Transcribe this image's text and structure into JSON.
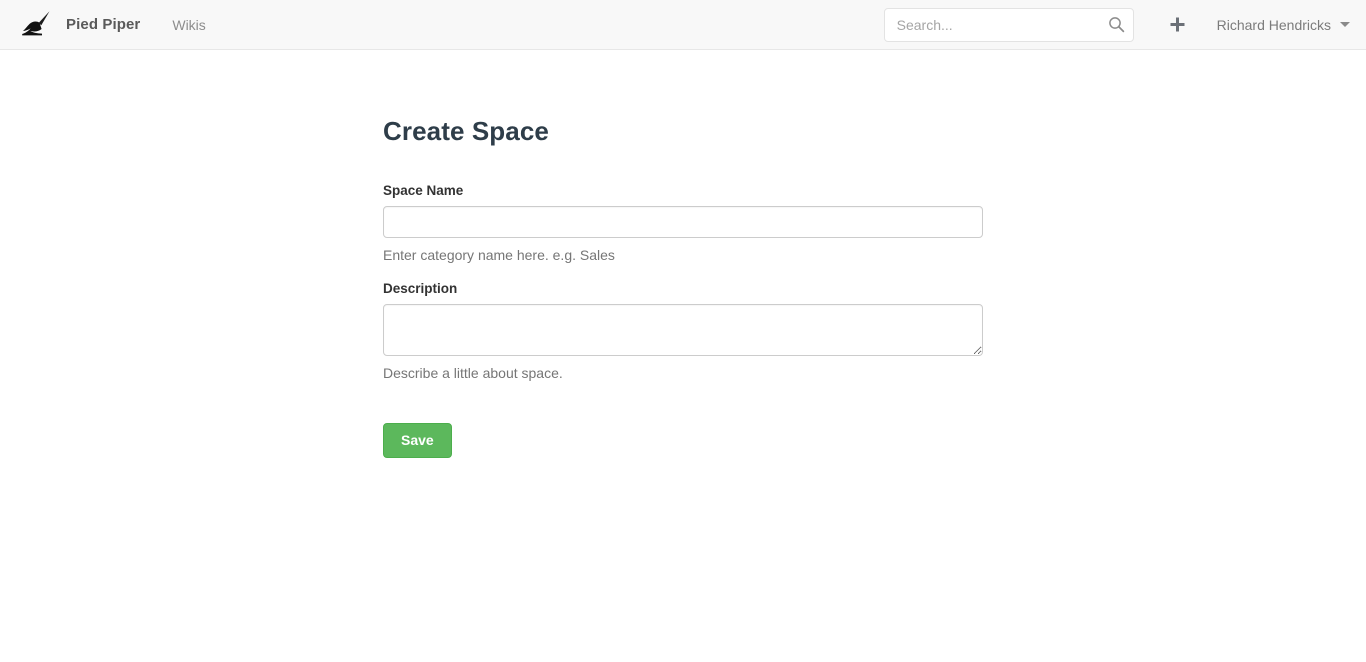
{
  "navbar": {
    "logo_icon": "quill-pen-icon",
    "brand": "Pied Piper",
    "links": [
      {
        "label": "Wikis",
        "name": "wikis"
      }
    ],
    "search": {
      "placeholder": "Search...",
      "value": "",
      "icon": "search-icon"
    },
    "add_button_icon": "plus-icon",
    "user": {
      "name": "Richard Hendricks",
      "caret_icon": "caret-down-icon"
    }
  },
  "main": {
    "title": "Create Space",
    "fields": [
      {
        "label": "Space Name",
        "type": "text",
        "value": "",
        "placeholder": "",
        "help": "Enter category name here. e.g. Sales"
      },
      {
        "label": "Description",
        "type": "textarea",
        "value": "",
        "placeholder": "",
        "help": "Describe a little about space."
      }
    ],
    "save_label": "Save"
  },
  "colors": {
    "accent_green": "#5cb85c",
    "navbar_bg": "#f8f8f8",
    "page_bg": "#ffffff",
    "title_text": "#2e3d49",
    "muted_text": "#767676"
  }
}
